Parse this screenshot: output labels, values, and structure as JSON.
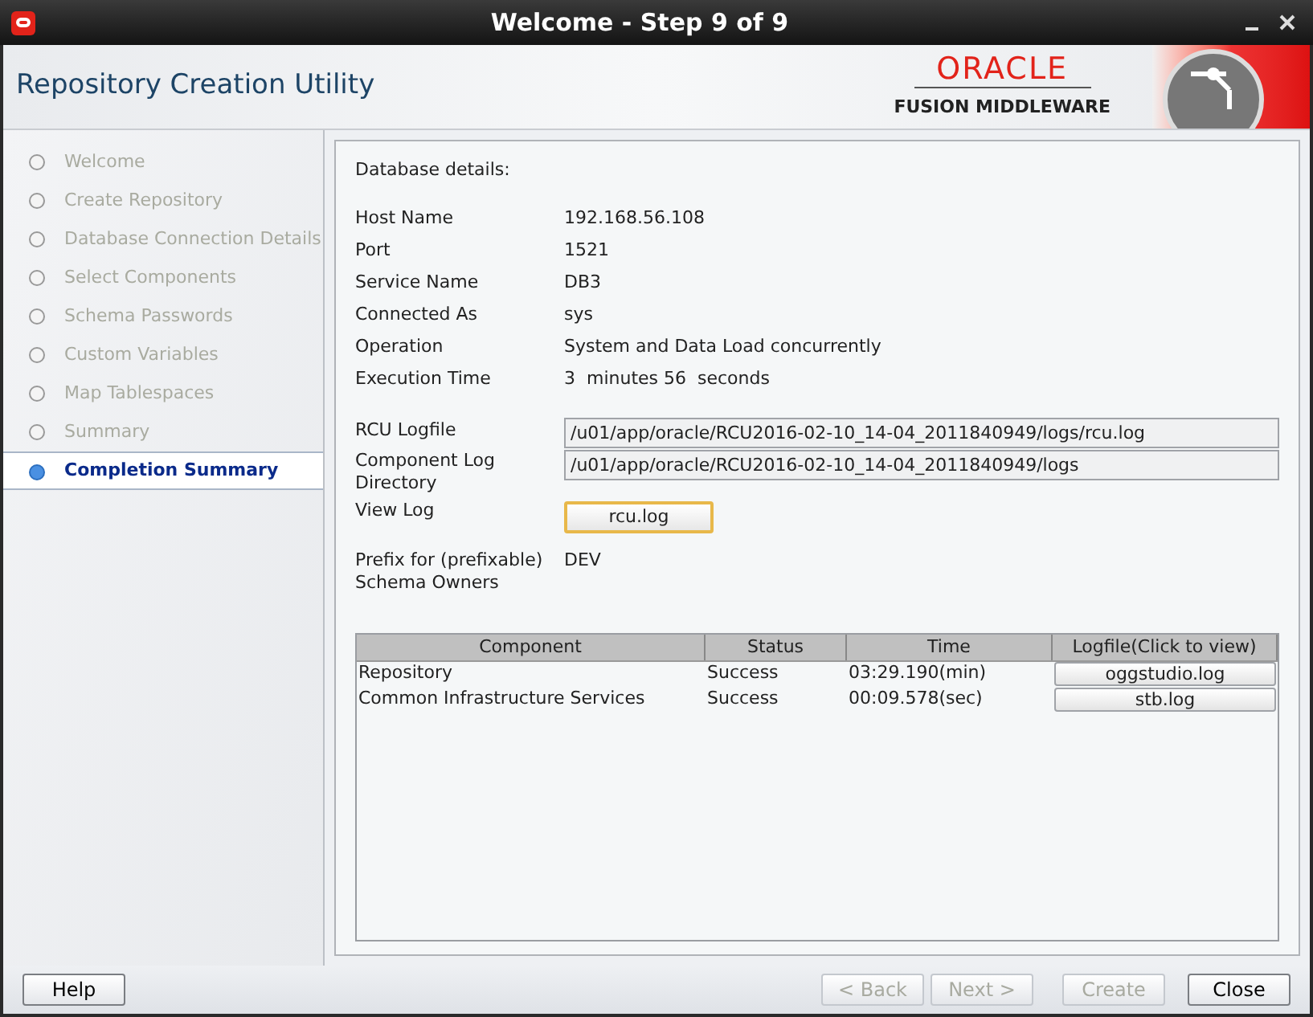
{
  "window": {
    "title": "Welcome - Step 9 of 9"
  },
  "header": {
    "title": "Repository Creation Utility",
    "brand": "ORACLE",
    "subtitle": "FUSION MIDDLEWARE"
  },
  "steps": [
    {
      "label": "Welcome",
      "selected": false
    },
    {
      "label": "Create Repository",
      "selected": false
    },
    {
      "label": "Database Connection Details",
      "selected": false
    },
    {
      "label": "Select Components",
      "selected": false
    },
    {
      "label": "Schema Passwords",
      "selected": false
    },
    {
      "label": "Custom Variables",
      "selected": false
    },
    {
      "label": "Map Tablespaces",
      "selected": false
    },
    {
      "label": "Summary",
      "selected": false
    },
    {
      "label": "Completion Summary",
      "selected": true
    }
  ],
  "content": {
    "heading": "Database details:",
    "details": [
      {
        "label": "Host Name",
        "value": "192.168.56.108"
      },
      {
        "label": "Port",
        "value": "1521"
      },
      {
        "label": "Service Name",
        "value": "DB3"
      },
      {
        "label": "Connected As",
        "value": "sys"
      },
      {
        "label": "Operation",
        "value": "System and Data Load concurrently"
      },
      {
        "label": "Execution Time",
        "value": "3  minutes 56  seconds"
      }
    ],
    "rcu_logfile": {
      "label": "RCU Logfile",
      "value": "/u01/app/oracle/RCU2016-02-10_14-04_2011840949/logs/rcu.log"
    },
    "component_log_directory": {
      "label": "Component Log Directory",
      "value": "/u01/app/oracle/RCU2016-02-10_14-04_2011840949/logs"
    },
    "view_log": {
      "label": "View Log",
      "button": "rcu.log"
    },
    "prefix": {
      "label": "Prefix for (prefixable) Schema Owners",
      "value": "DEV"
    }
  },
  "table": {
    "columns": [
      "Component",
      "Status",
      "Time",
      "Logfile(Click to view)"
    ],
    "rows": [
      {
        "component": "Repository",
        "status": "Success",
        "time": "03:29.190(min)",
        "logfile": "oggstudio.log"
      },
      {
        "component": "Common Infrastructure Services",
        "status": "Success",
        "time": "00:09.578(sec)",
        "logfile": "stb.log"
      }
    ]
  },
  "footer": {
    "buttons": [
      {
        "label": "Help",
        "disabled": false
      },
      {
        "label": "< Back",
        "disabled": true
      },
      {
        "label": "Next >",
        "disabled": true
      },
      {
        "label": "Create",
        "disabled": true
      },
      {
        "label": "Close",
        "disabled": false
      }
    ]
  }
}
